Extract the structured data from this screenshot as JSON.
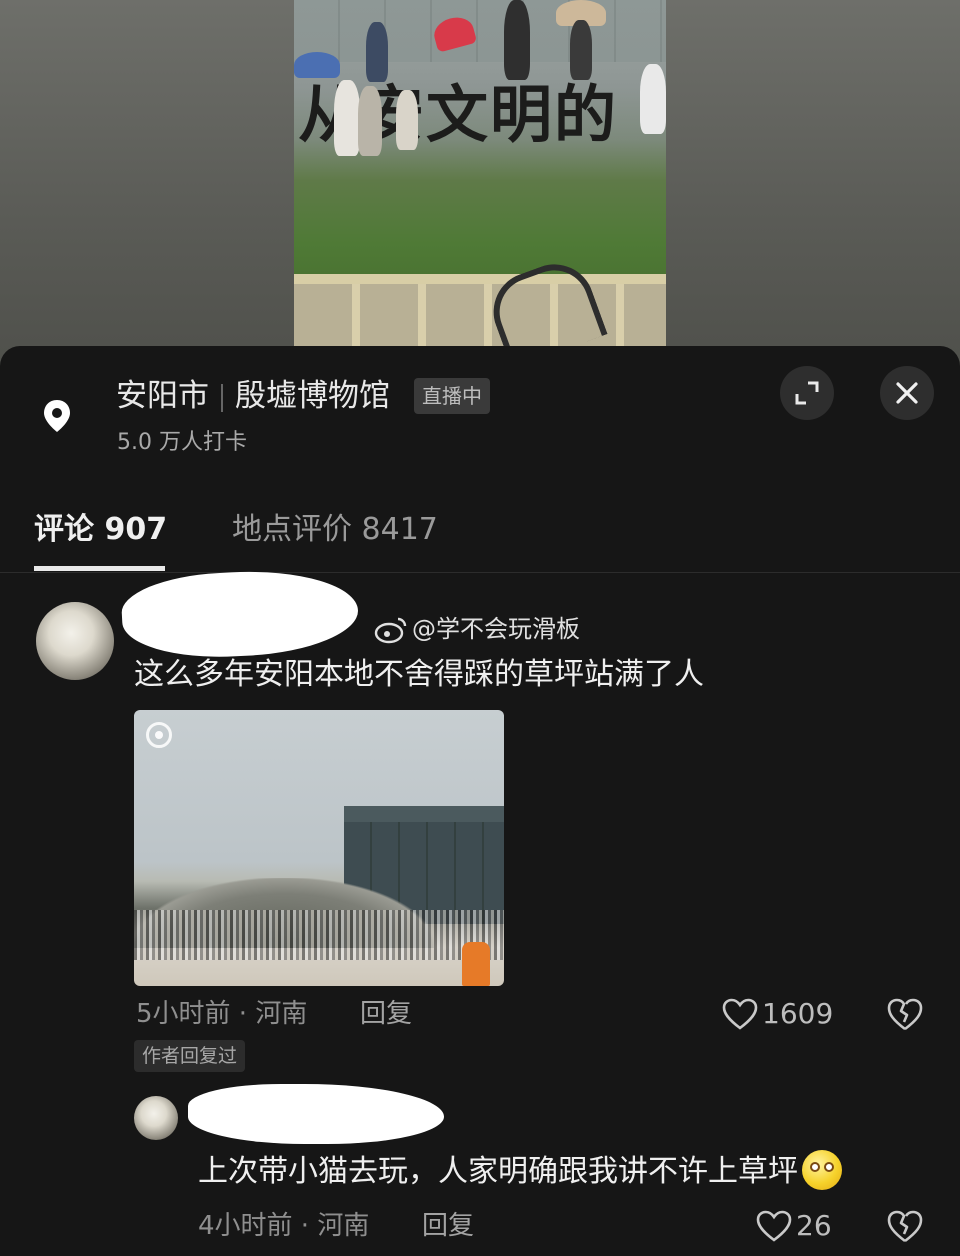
{
  "location": {
    "city": "安阳市",
    "venue": "殷墟博物馆",
    "live_badge": "直播中",
    "checkins": "5.0 万人打卡",
    "sign_text": "从安文明的"
  },
  "tabs": [
    {
      "label": "评论 907",
      "active": true
    },
    {
      "label": "地点评价 8417",
      "active": false
    }
  ],
  "comments": [
    {
      "weibo_tag": "@学不会玩滑板",
      "text": "这么多年安阳本地不舍得踩的草坪站满了人",
      "time_location": "5小时前 · 河南",
      "reply_label": "回复",
      "likes": "1609",
      "author_tag": "作者回复过"
    },
    {
      "text": "上次带小猫去玩，人家明确跟我讲不许上草坪",
      "emoji": "smiley-emoji",
      "time_location": "4小时前 · 河南",
      "reply_label": "回复",
      "likes": "26"
    }
  ],
  "colors": {
    "sheet_bg": "#161616",
    "text_primary": "#efefef",
    "text_secondary": "#8f8f8f"
  },
  "icons": {
    "location": "location-pin-icon",
    "expand": "expand-icon",
    "close": "close-icon",
    "weibo": "weibo-icon",
    "like": "heart-icon",
    "dislike": "broken-heart-icon"
  }
}
